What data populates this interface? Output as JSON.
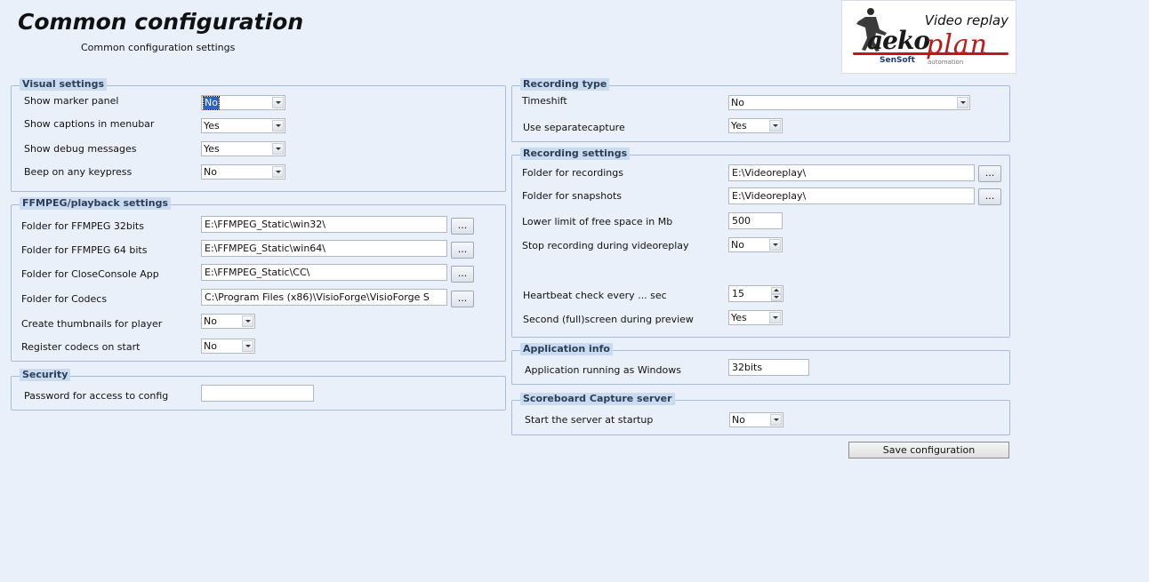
{
  "header": {
    "title": "Common configuration",
    "subtitle": "Common configuration settings"
  },
  "logo": {
    "tagline": "Video replay",
    "brand_left": "aeko",
    "brand_right": "plan",
    "company": "SenSoft",
    "company_sub": "automation"
  },
  "visual": {
    "legend": "Visual settings",
    "marker_label": "Show marker panel",
    "marker_value": "No",
    "captions_label": "Show captions in menubar",
    "captions_value": "Yes",
    "debug_label": "Show debug messages",
    "debug_value": "Yes",
    "beep_label": "Beep on any keypress",
    "beep_value": "No"
  },
  "ffmpeg": {
    "legend": "FFMPEG/playback settings",
    "f32_label": "Folder for FFMPEG 32bits",
    "f32_value": "E:\\FFMPEG_Static\\win32\\",
    "f64_label": "Folder for FFMPEG 64 bits",
    "f64_value": "E:\\FFMPEG_Static\\win64\\",
    "cc_label": "Folder for CloseConsole App",
    "cc_value": "E:\\FFMPEG_Static\\CC\\",
    "codecs_label": "Folder for Codecs",
    "codecs_value": "C:\\Program Files (x86)\\VisioForge\\VisioForge S",
    "thumbs_label": "Create thumbnails for player",
    "thumbs_value": "No",
    "register_label": "Register codecs on start",
    "register_value": "No",
    "browse_label": "..."
  },
  "security": {
    "legend": "Security",
    "password_label": "Password for access to config",
    "password_value": ""
  },
  "rectype": {
    "legend": "Recording type",
    "timeshift_label": "Timeshift",
    "timeshift_value": "No",
    "separate_label": "Use separatecapture",
    "separate_value": "Yes"
  },
  "recsettings": {
    "legend": "Recording settings",
    "rec_folder_label": "Folder for recordings",
    "rec_folder_value": "E:\\Videoreplay\\",
    "snap_folder_label": "Folder for snapshots",
    "snap_folder_value": "E:\\Videoreplay\\",
    "lower_label": "Lower limit of free space in Mb",
    "lower_value": "500",
    "stop_label": "Stop recording during videoreplay",
    "stop_value": "No",
    "heartbeat_label": "Heartbeat check every ... sec",
    "heartbeat_value": "15",
    "second_label": "Second (full)screen during preview",
    "second_value": "Yes"
  },
  "appinfo": {
    "legend": "Application info",
    "running_label": "Application running as Windows",
    "running_value": "32bits"
  },
  "scoreboard": {
    "legend": "Scoreboard Capture server",
    "start_label": "Start the server at startup",
    "start_value": "No"
  },
  "actions": {
    "save_label": "Save configuration"
  }
}
